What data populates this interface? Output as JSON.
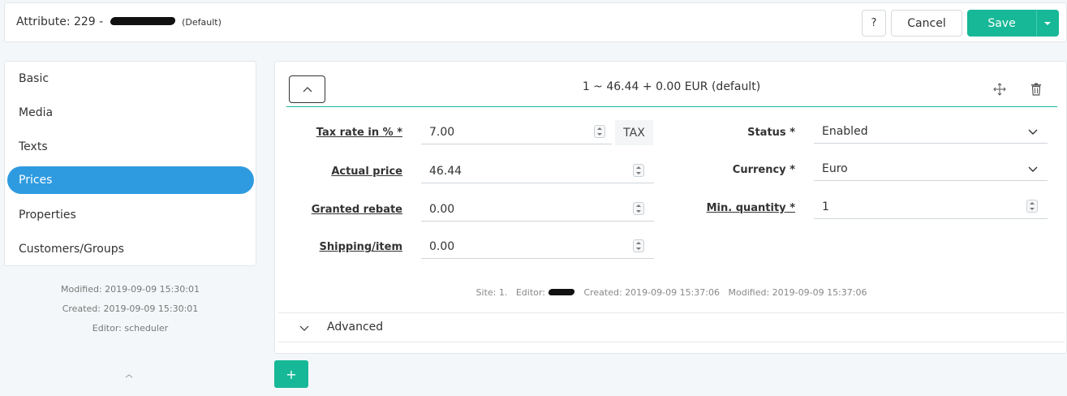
{
  "header": {
    "title_prefix": "Attribute: 229 -",
    "title_suffix": "(Default)",
    "help_label": "?",
    "cancel_label": "Cancel",
    "save_label": "Save"
  },
  "sidebar": {
    "items": [
      {
        "label": "Basic"
      },
      {
        "label": "Media"
      },
      {
        "label": "Texts"
      },
      {
        "label": "Prices"
      },
      {
        "label": "Properties"
      },
      {
        "label": "Customers/Groups"
      }
    ],
    "active": "Prices",
    "modified": "Modified: 2019-09-09 15:30:01",
    "created": "Created: 2019-09-09 15:30:01",
    "editor": "Editor: scheduler"
  },
  "price": {
    "summary": "1 ~ 46.44 + 0.00 EUR (default)",
    "tax_rate": {
      "label": "Tax rate in %",
      "required": "*",
      "value": "7.00",
      "addon": "TAX"
    },
    "actual_price": {
      "label": "Actual price",
      "value": "46.44"
    },
    "granted_rebate": {
      "label": "Granted rebate",
      "value": "0.00"
    },
    "shipping": {
      "label": "Shipping/item",
      "value": "0.00"
    },
    "status": {
      "label": "Status",
      "required": "*",
      "value": "Enabled"
    },
    "currency": {
      "label": "Currency",
      "required": "*",
      "value": "Euro"
    },
    "min_quantity": {
      "label": "Min. quantity",
      "required": "*",
      "value": "1"
    },
    "meta": {
      "site": "Site: 1.",
      "editor": "Editor:",
      "created": "Created: 2019-09-09 15:37:06",
      "modified": "Modified: 2019-09-09 15:37:06"
    },
    "advanced_label": "Advanced"
  },
  "add_button": "+",
  "colors": {
    "accent": "#17b897",
    "active_nav": "#2e9be0"
  }
}
